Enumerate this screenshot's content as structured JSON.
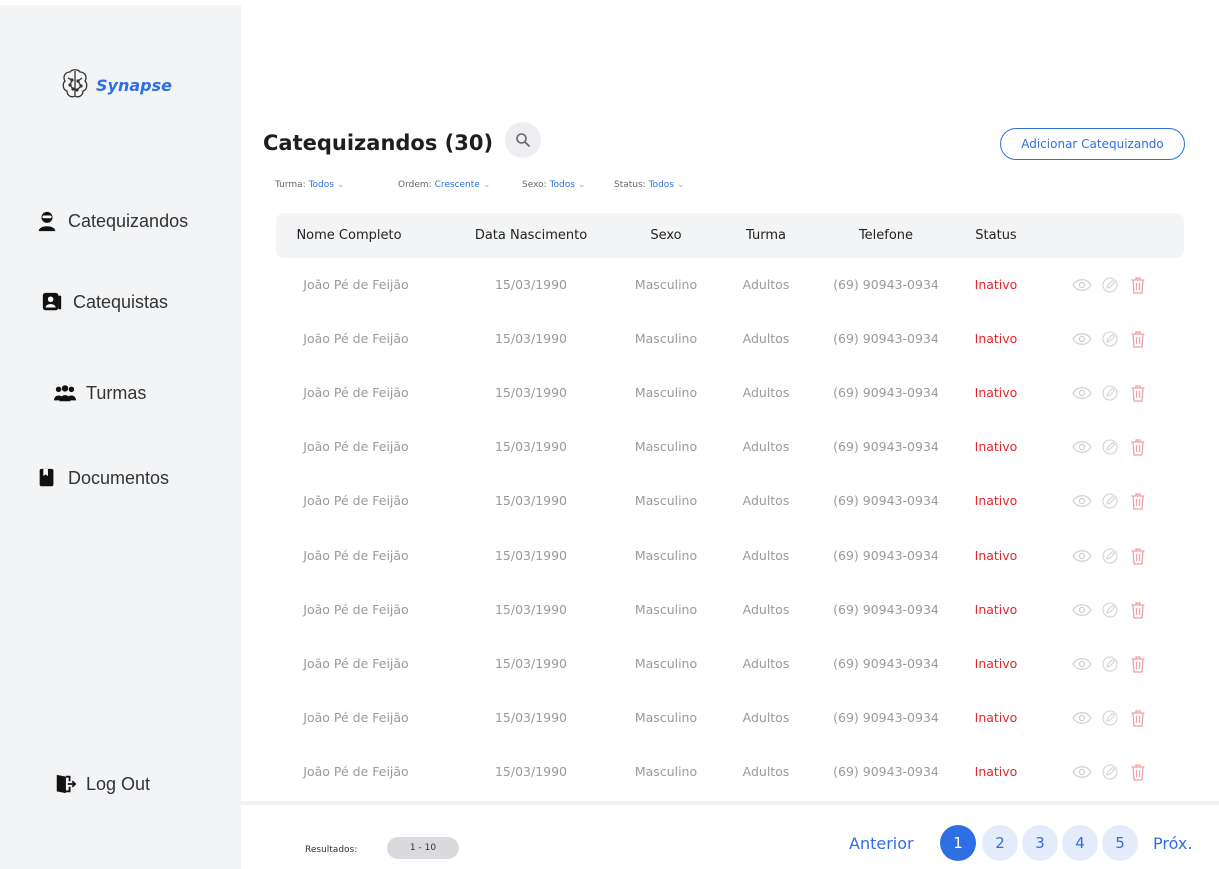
{
  "brand": {
    "name": "Synapse",
    "color": "#2f6fe4"
  },
  "sidebar": {
    "items": [
      {
        "label": "Catequizandos",
        "icon": "user-mask-icon"
      },
      {
        "label": "Catequistas",
        "icon": "contacts-book-icon"
      },
      {
        "label": "Turmas",
        "icon": "group-icon"
      },
      {
        "label": "Documentos",
        "icon": "bookmark-icon"
      }
    ],
    "logout": {
      "label": "Log Out",
      "icon": "door-exit-icon"
    }
  },
  "header": {
    "title": "Catequizandos (30)",
    "search_icon": "search-icon",
    "add_button": "Adicionar Catequizando"
  },
  "filters": [
    {
      "label": "Turma:",
      "value": "Todos"
    },
    {
      "label": "Ordem:",
      "value": "Crescente"
    },
    {
      "label": "Sexo:",
      "value": "Todos"
    },
    {
      "label": "Status:",
      "value": "Todos"
    }
  ],
  "table": {
    "columns": [
      "Nome Completo",
      "Data Nascimento",
      "Sexo",
      "Turma",
      "Telefone",
      "Status"
    ],
    "rows": [
      [
        "João Pé de Feijão",
        "15/03/1990",
        "Masculino",
        "Adultos",
        "(69) 90943-0934",
        "Inativo"
      ],
      [
        "João Pé de Feijão",
        "15/03/1990",
        "Masculino",
        "Adultos",
        "(69) 90943-0934",
        "Inativo"
      ],
      [
        "João Pé de Feijão",
        "15/03/1990",
        "Masculino",
        "Adultos",
        "(69) 90943-0934",
        "Inativo"
      ],
      [
        "João Pé de Feijão",
        "15/03/1990",
        "Masculino",
        "Adultos",
        "(69) 90943-0934",
        "Inativo"
      ],
      [
        "João Pé de Feijão",
        "15/03/1990",
        "Masculino",
        "Adultos",
        "(69) 90943-0934",
        "Inativo"
      ],
      [
        "João Pé de Feijão",
        "15/03/1990",
        "Masculino",
        "Adultos",
        "(69) 90943-0934",
        "Inativo"
      ],
      [
        "João Pé de Feijão",
        "15/03/1990",
        "Masculino",
        "Adultos",
        "(69) 90943-0934",
        "Inativo"
      ],
      [
        "João Pé de Feijão",
        "15/03/1990",
        "Masculino",
        "Adultos",
        "(69) 90943-0934",
        "Inativo"
      ],
      [
        "João Pé de Feijão",
        "15/03/1990",
        "Masculino",
        "Adultos",
        "(69) 90943-0934",
        "Inativo"
      ],
      [
        "João Pé de Feijão",
        "15/03/1990",
        "Masculino",
        "Adultos",
        "(69) 90943-0934",
        "Inativo"
      ]
    ],
    "row_actions": [
      "eye-icon",
      "edit-icon",
      "trash-icon"
    ],
    "status_color": "#e5252a"
  },
  "footer": {
    "results_label": "Resultados:",
    "results_range": "1 - 10",
    "prev": "Anterior",
    "pages": [
      "1",
      "2",
      "3",
      "4",
      "5"
    ],
    "current_page": "1",
    "next": "Próx."
  }
}
